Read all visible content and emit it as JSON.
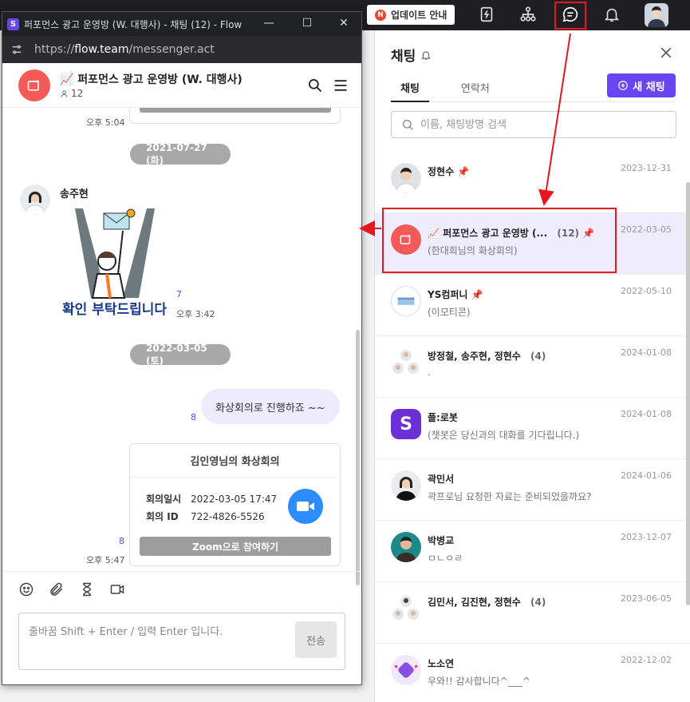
{
  "topbar": {
    "update_label": "업데이트 안내",
    "update_badge": "N"
  },
  "window": {
    "title": "퍼포먼스 광고 운영방 (W. 대행사) - 채팅 (12) - Flow",
    "url_scheme": "https://",
    "url_host": "flow.team",
    "url_path": "/messenger.act"
  },
  "room": {
    "title": "📈 퍼포먼스 광고 운영방 (W. 대행사)",
    "members": "12"
  },
  "messages": {
    "prev_time": "오후 5:04",
    "date1": "2021-07-27 (화)",
    "sender": "송주현",
    "sticker_text": "확인 부탁드립니다",
    "sticker_unread": "7",
    "sticker_time": "오후 3:42",
    "date2": "2022-03-05 (토)",
    "my_unread": "8",
    "my_text": "화상회의로 진행하죠 ~~",
    "card_title": "김인영님의 화상회의",
    "card_date_label": "회의일시",
    "card_date": "2022-03-05 17:47",
    "card_id_label": "회의 ID",
    "card_id": "722-4826-5526",
    "card_button": "Zoom으로 참여하기",
    "card_unread": "8",
    "card_time": "오후 5:47"
  },
  "composer": {
    "placeholder": "줄바꿈 Shift + Enter / 입력 Enter 입니다.",
    "send": "전송"
  },
  "panel": {
    "title": "채팅",
    "tab_chat": "채팅",
    "tab_contacts": "연락처",
    "new_chat": "새 채팅",
    "search_placeholder": "이름, 채팅방명 검색",
    "chats": [
      {
        "name": "정현수",
        "sub": "",
        "date": "2023-12-31",
        "pin": true
      },
      {
        "name": "📈 퍼포먼스 광고 운영방 (...",
        "count": "(12)",
        "sub": "(한대희님의 화상회의)",
        "date": "2022-03-05",
        "pin": true
      },
      {
        "name": "YS컴퍼니",
        "sub": "(이모티콘)",
        "date": "2022-05-10",
        "pin": true
      },
      {
        "name": "방정철, 송주현, 정현수",
        "count": "(4)",
        "sub": ".",
        "date": "2024-01-08"
      },
      {
        "name": "플:로봇",
        "sub": "(챗봇은 당신과의 대화를 기다립니다.)",
        "date": "2024-01-08"
      },
      {
        "name": "곽민서",
        "sub": "곽프로님 요청한 자료는 준비되었을까요?",
        "date": "2024-01-06"
      },
      {
        "name": "박병교",
        "sub": "ㅁㄴㅇㄹ",
        "date": "2023-12-07"
      },
      {
        "name": "김민서, 김진현, 정현수",
        "count": "(4)",
        "sub": "",
        "date": "2023-06-05"
      },
      {
        "name": "노소연",
        "sub": "우와!! 감사합니다^___^",
        "date": "2022-12-02"
      }
    ]
  },
  "colors": {
    "accent": "#6845f0",
    "highlight": "#e8161f",
    "room_icon": "#f45a57",
    "zoom": "#2d8cff"
  }
}
